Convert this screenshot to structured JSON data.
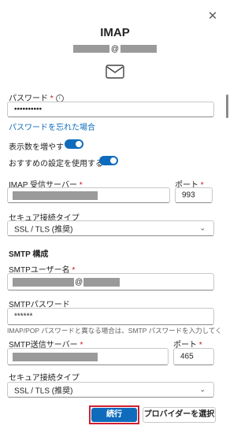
{
  "dialog": {
    "title": "IMAP",
    "email_at": "@",
    "close_icon": "close-icon",
    "mail_icon": "mail-icon"
  },
  "password": {
    "label": "パスワード",
    "required": "*",
    "value": "••••••••••",
    "forgot_link": "パスワードを忘れた場合"
  },
  "toggles": {
    "show_more_label": "表示数を増やす",
    "show_more_on": true,
    "recommended_label": "おすすめの設定を使用する",
    "recommended_on": true
  },
  "imap": {
    "server_label": "IMAP 受信サーバー",
    "required": "*",
    "port_label": "ポート",
    "port_value": "993",
    "security_label": "セキュア接続タイプ",
    "security_value": "SSL / TLS (推奨)"
  },
  "smtp": {
    "section_title": "SMTP 構成",
    "username_label": "SMTPユーザー名",
    "username_at": "@",
    "password_label": "SMTPパスワード",
    "password_value": "******",
    "password_hint": "IMAP/POP パスワードと異なる場合は、SMTP パスワードを入力してくださ",
    "server_label": "SMTP送信サーバー",
    "port_label": "ポート",
    "port_value": "465",
    "security_label": "セキュア接続タイプ",
    "security_value": "SSL / TLS (推奨)"
  },
  "buttons": {
    "continue_label": "続行",
    "choose_provider_label": "プロバイダーを選択"
  },
  "colors": {
    "accent": "#0f6cbd",
    "required": "#c50f1f",
    "highlight": "#d1202f"
  }
}
